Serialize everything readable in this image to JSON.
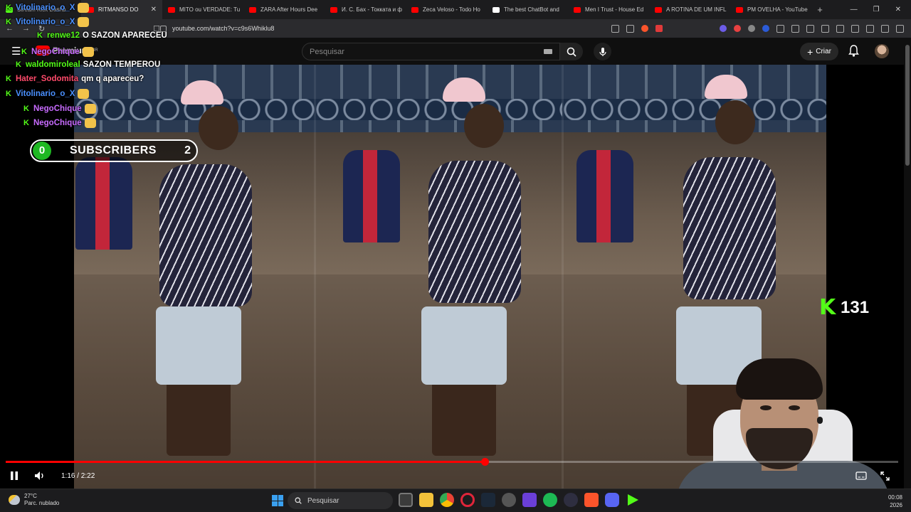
{
  "browser": {
    "tabs": [
      {
        "label": "Stream Kick Dashb",
        "color": "#53fc18",
        "active": false
      },
      {
        "label": "RITMANSO DO",
        "color": "#ff0000",
        "active": true
      },
      {
        "label": "MITO ou VERDADE: Tu",
        "color": "#ff0000",
        "active": false
      },
      {
        "label": "ZARA After Hours Dee",
        "color": "#ff0000",
        "active": false
      },
      {
        "label": "И. С. Бах - Токката и ф",
        "color": "#ff0000",
        "active": false
      },
      {
        "label": "Zeca Veloso - Todo Ho",
        "color": "#ff0000",
        "active": false
      },
      {
        "label": "The best ChatBot and",
        "color": "#ffffff",
        "active": false
      },
      {
        "label": "Men I Trust - House Ed",
        "color": "#ff0000",
        "active": false
      },
      {
        "label": "A ROTINA DE UM INFL",
        "color": "#ff0000",
        "active": false
      },
      {
        "label": "PM OVELHA - YouTube",
        "color": "#ff0000",
        "active": false
      }
    ],
    "new_tab": "+",
    "url": "youtube.com/watch?v=c9s6Whiklu8"
  },
  "youtube": {
    "search_placeholder": "Pesquisar",
    "create_label": "Criar",
    "premium_label": "Premium",
    "premium_badge": "BR"
  },
  "player": {
    "time": "1:16 / 2:22",
    "progress_fraction": 0.537
  },
  "stream_overlay": {
    "chat": [
      {
        "user": "Vitolinario_o_X",
        "color": "#4a90ff",
        "msg": "",
        "emote": true,
        "indent": 0
      },
      {
        "user": "Vitolinario_o_X",
        "color": "#4a90ff",
        "msg": "",
        "emote": true,
        "indent": 0
      },
      {
        "user": "renwe12",
        "color": "#53fc18",
        "msg": "O SAZON APARECEU",
        "emote": false,
        "indent": 2
      },
      {
        "user": "NegoChique",
        "color": "#c86bff",
        "msg": "",
        "emote": true,
        "indent": 1
      },
      {
        "user": "waldomiroleal",
        "color": "#53fc18",
        "msg": "SAZON TEMPEROU",
        "emote": false,
        "indent": 1
      },
      {
        "user": "Hater_Sodomita",
        "color": "#ff4a6a",
        "msg": "qm q apareceu?",
        "emote": false,
        "indent": 0
      },
      {
        "user": "Vitolinario_o_X",
        "color": "#4a90ff",
        "msg": "",
        "emote": true,
        "indent": 0
      },
      {
        "user": "NegoChique",
        "color": "#c86bff",
        "msg": "",
        "emote": true,
        "indent": 1
      },
      {
        "user": "NegoChique",
        "color": "#c86bff",
        "msg": "",
        "emote": true,
        "indent": 1
      }
    ],
    "subs_left": "0",
    "subs_label": "SUBSCRIBERS",
    "subs_right": "2",
    "viewers_count": "131"
  },
  "taskbar": {
    "temperature": "27°C",
    "weather_desc": "Parc. nublado",
    "search_label": "Pesquisar",
    "time": "00:08",
    "date": "2026"
  }
}
